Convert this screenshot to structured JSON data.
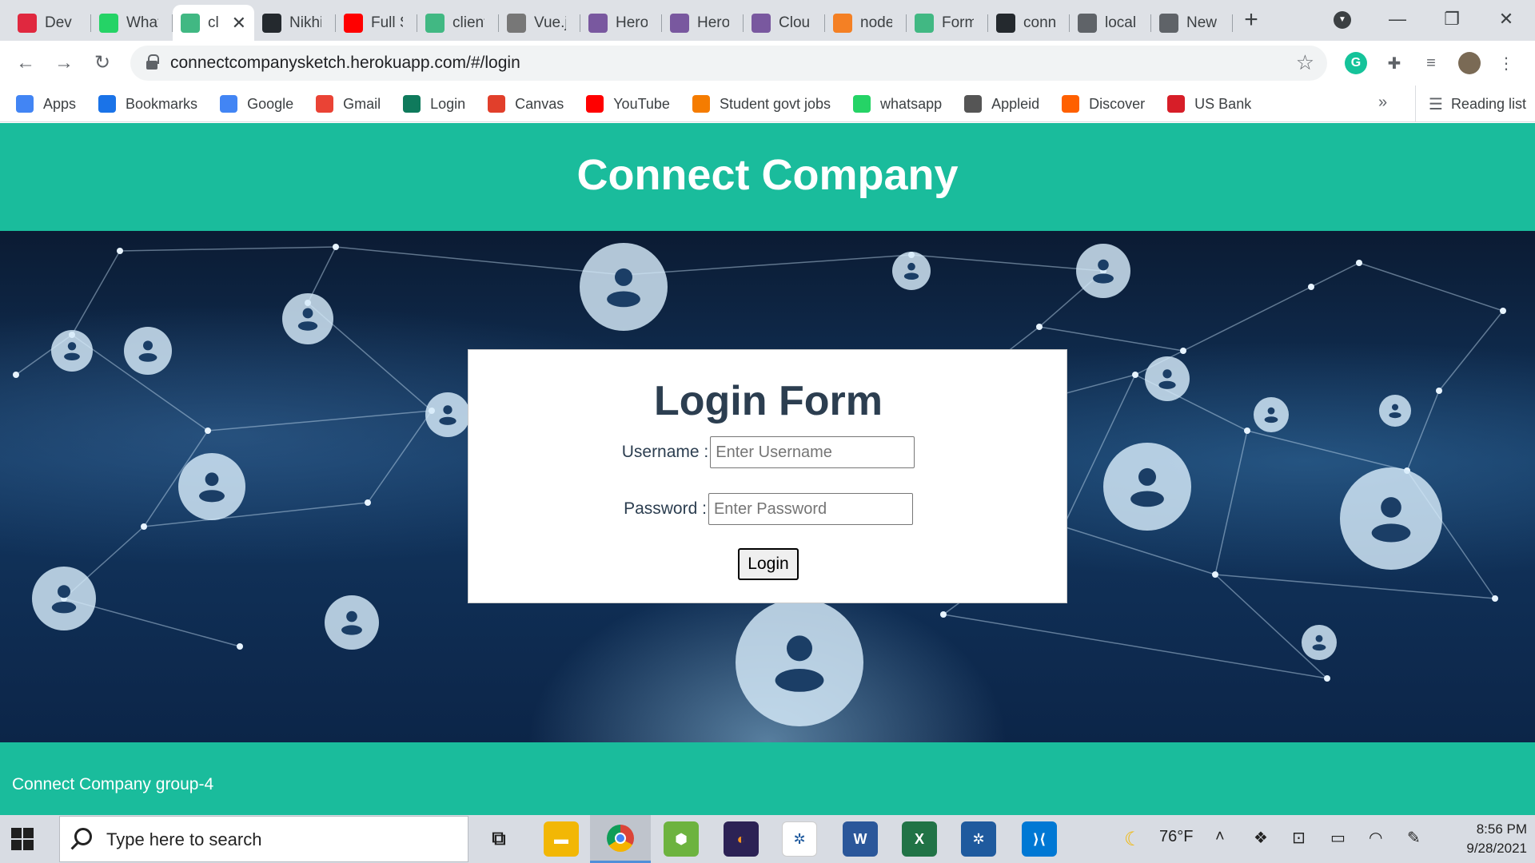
{
  "browser": {
    "tabs": [
      {
        "title": "Dev F",
        "icon": "dev-icon",
        "color": "#e0283f"
      },
      {
        "title": "What",
        "icon": "whatsapp-icon",
        "color": "#25d366"
      },
      {
        "title": "cl",
        "icon": "vue-icon",
        "color": "#41b883",
        "active": true
      },
      {
        "title": "Nikhi",
        "icon": "github-icon",
        "color": "#24292e"
      },
      {
        "title": "Full S",
        "icon": "youtube-icon",
        "color": "#ff0000"
      },
      {
        "title": "client",
        "icon": "vue-icon",
        "color": "#41b883"
      },
      {
        "title": "Vue.js",
        "icon": "person-icon",
        "color": "#777777"
      },
      {
        "title": "Hero",
        "icon": "heroku-icon",
        "color": "#79589f"
      },
      {
        "title": "Hero",
        "icon": "heroku-icon",
        "color": "#79589f"
      },
      {
        "title": "Clou",
        "icon": "heroku-icon",
        "color": "#79589f"
      },
      {
        "title": "node",
        "icon": "stackoverflow-icon",
        "color": "#f48024"
      },
      {
        "title": "Form",
        "icon": "vue-icon",
        "color": "#41b883"
      },
      {
        "title": "conn",
        "icon": "github-icon",
        "color": "#24292e"
      },
      {
        "title": "local",
        "icon": "globe-icon",
        "color": "#5f6368"
      },
      {
        "title": "New",
        "icon": "chrome-icon",
        "color": "#5f6368"
      }
    ],
    "url": "connectcompanysketch.herokuapp.com/#/login",
    "bookmarks": [
      {
        "label": "Apps",
        "icon": "apps-grid-icon",
        "color": "#4285f4"
      },
      {
        "label": "Bookmarks",
        "icon": "star-icon",
        "color": "#1a73e8"
      },
      {
        "label": "Google",
        "icon": "google-icon",
        "color": "#4285f4"
      },
      {
        "label": "Gmail",
        "icon": "gmail-icon",
        "color": "#ea4335"
      },
      {
        "label": "Login",
        "icon": "n-icon",
        "color": "#0f7a5c"
      },
      {
        "label": "Canvas",
        "icon": "canvas-icon",
        "color": "#e13f2b"
      },
      {
        "label": "YouTube",
        "icon": "youtube-icon",
        "color": "#ff0000"
      },
      {
        "label": "Student govt jobs",
        "icon": "building-icon",
        "color": "#f57c00"
      },
      {
        "label": "whatsapp",
        "icon": "whatsapp-icon",
        "color": "#25d366"
      },
      {
        "label": "Appleid",
        "icon": "apple-icon",
        "color": "#555555"
      },
      {
        "label": "Discover",
        "icon": "discover-icon",
        "color": "#ff6000"
      },
      {
        "label": "US Bank",
        "icon": "shield-icon",
        "color": "#d71e28"
      }
    ],
    "reading_list": "Reading list"
  },
  "page": {
    "header_title": "Connect Company",
    "login": {
      "title": "Login Form",
      "username_label": "Username :",
      "username_placeholder": "Enter Username",
      "password_label": "Password :",
      "password_placeholder": "Enter Password",
      "button_label": "Login"
    },
    "footer": "Connect Company group-4",
    "colors": {
      "accent": "#1abc9c",
      "text": "#2c3e50"
    }
  },
  "taskbar": {
    "search_placeholder": "Type here to search",
    "weather": "76°F",
    "time": "8:56 PM",
    "date": "9/28/2021"
  }
}
